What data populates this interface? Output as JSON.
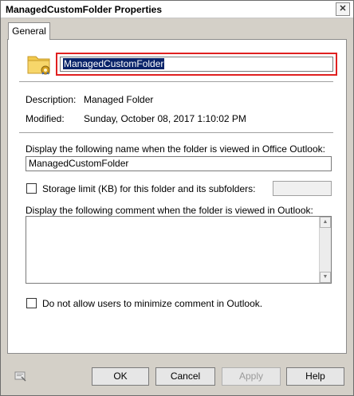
{
  "window": {
    "title": "ManagedCustomFolder Properties"
  },
  "tabs": [
    {
      "label": "General"
    }
  ],
  "general": {
    "name_value": "ManagedCustomFolder",
    "description_label": "Description:",
    "description_value": "Managed Folder",
    "modified_label": "Modified:",
    "modified_value": "Sunday, October 08, 2017 1:10:02 PM",
    "display_name_label": "Display the following name when the folder is viewed in Office Outlook:",
    "display_name_value": "ManagedCustomFolder",
    "storage_limit_label": "Storage limit (KB) for this folder and its subfolders:",
    "storage_limit_checked": false,
    "storage_limit_value": "",
    "comment_label": "Display the following comment when the folder is viewed in Outlook:",
    "comment_value": "",
    "no_minimize_label": "Do not allow users to minimize comment in Outlook.",
    "no_minimize_checked": false
  },
  "buttons": {
    "ok": "OK",
    "cancel": "Cancel",
    "apply": "Apply",
    "help": "Help"
  },
  "icons": {
    "folder": "managed-folder-icon",
    "footer": "help-context-icon",
    "close": "close-icon"
  }
}
